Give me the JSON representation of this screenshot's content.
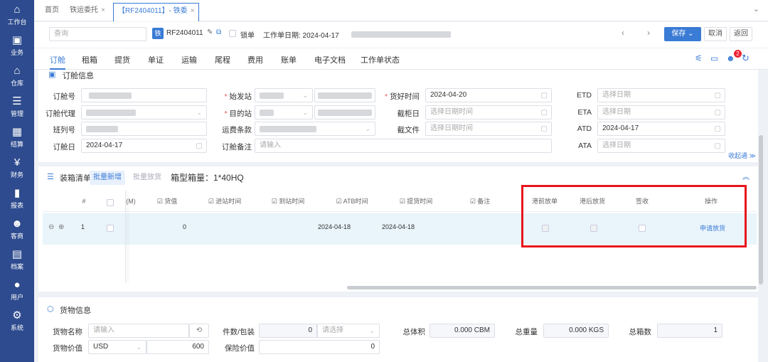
{
  "sidebar": {
    "items": [
      {
        "label": "工作台",
        "icon": "home-icon",
        "glyph": "⌂"
      },
      {
        "label": "业务",
        "icon": "business-icon",
        "glyph": "▣"
      },
      {
        "label": "仓库",
        "icon": "warehouse-icon",
        "glyph": "⌂"
      },
      {
        "label": "管理",
        "icon": "management-icon",
        "glyph": "☰"
      },
      {
        "label": "结算",
        "icon": "settlement-icon",
        "glyph": "▦"
      },
      {
        "label": "财务",
        "icon": "finance-icon",
        "glyph": "¥"
      },
      {
        "label": "报表",
        "icon": "report-icon",
        "glyph": "▮"
      },
      {
        "label": "客商",
        "icon": "customer-icon",
        "glyph": "☻"
      },
      {
        "label": "档案",
        "icon": "archive-icon",
        "glyph": "▤"
      },
      {
        "label": "用户",
        "icon": "user-icon",
        "glyph": "●"
      },
      {
        "label": "系统",
        "icon": "system-icon",
        "glyph": "⚙"
      }
    ]
  },
  "tabs": {
    "home": "首页",
    "rail_entrust": "铁运委托",
    "current": "【RF2404011】- 铁委",
    "close": "×"
  },
  "toolbar": {
    "search_placeholder": "查询",
    "badge": "铁",
    "order_no": "RF2404011",
    "lock_label": "锁单",
    "date_label": "工作单日期: 2024-04-17",
    "save": "保存",
    "cancel": "取消",
    "back": "返回"
  },
  "nav": [
    "订舱",
    "租箱",
    "提货",
    "单证",
    "运输",
    "尾程",
    "费用",
    "账单",
    "电子文档",
    "工作单状态"
  ],
  "booking": {
    "title": "订舱信息",
    "booking_no": "订舱号",
    "booking_agent": "订舱代理",
    "train_no": "班列号",
    "booking_date": "订舱日",
    "booking_date_value": "2024-04-17",
    "origin": "始发站",
    "destination": "目的站",
    "freight_terms": "运费条款",
    "booking_remark": "订舱备注",
    "remark_placeholder": "请输入",
    "cargo_ready": "货好时间",
    "cargo_ready_value": "2024-04-20",
    "cy_cutoff": "截柜日",
    "doc_cutoff": "截文件",
    "datetime_placeholder": "选择日期时间",
    "etd": "ETD",
    "eta": "ETA",
    "atd": "ATD",
    "ata": "ATA",
    "date_placeholder": "选择日期",
    "atd_value": "2024-04-17",
    "collapse": "收起通"
  },
  "packing": {
    "title": "装箱清单",
    "batch_add": "批量新增",
    "batch_release": "批量放货",
    "container_qty": "箱型箱量：1*40HQ",
    "headers": [
      "#",
      "(M)",
      "货值",
      "进站时间",
      "到站时间",
      "ATB时间",
      "提货时间",
      "备注",
      "港前放单",
      "港后放货",
      "签收",
      "操作"
    ],
    "row": {
      "index": "1",
      "value": "0",
      "atb": "2024-04-18",
      "pickup": "2024-04-18",
      "action": "申请放货"
    }
  },
  "cargo": {
    "title": "货物信息",
    "name_label": "货物名称",
    "name_placeholder": "请输入",
    "pieces_label": "件数/包装",
    "pieces_value": "0",
    "pack_placeholder": "请选择",
    "volume_label": "总体积",
    "volume_value": "0.000 CBM",
    "weight_label": "总重量",
    "weight_value": "0.000 KGS",
    "boxes_label": "总箱数",
    "boxes_value": "1",
    "value_label": "货物价值",
    "currency": "USD",
    "value_amount": "600",
    "insured_label": "保险价值",
    "insured_value": "0"
  },
  "notify_count": "2",
  "colors": {
    "sidebar": "#2d4b8e",
    "accent": "#3a7bd5",
    "highlight": "#e8141c"
  }
}
